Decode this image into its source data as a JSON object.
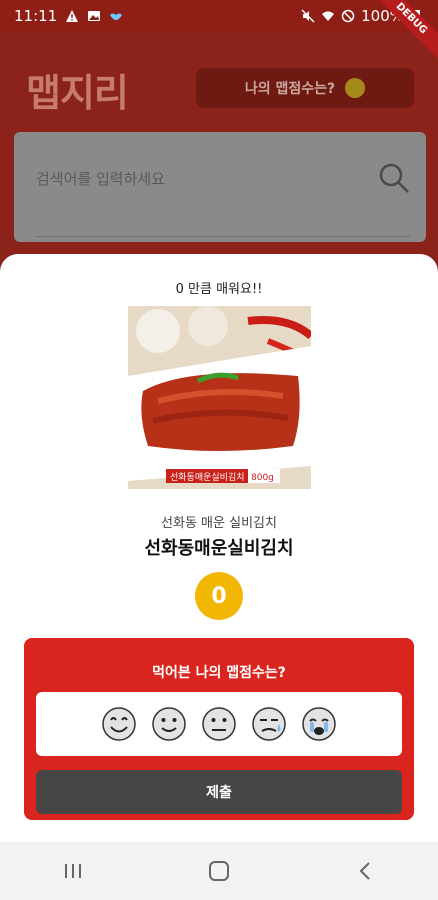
{
  "status_bar": {
    "time": "11:11",
    "battery": "100%"
  },
  "debug_label": "DEBUG",
  "app": {
    "logo": "맵지리",
    "score_button": "나의 맵점수는?",
    "search_placeholder": "검색어를 입력하세요"
  },
  "sheet": {
    "title": "0 만큼 매워요!!",
    "product_subtitle": "선화동 매운 실비김치",
    "product_name": "선화동매운실비김치",
    "score": "0",
    "image_label": "선화동매운실비김치",
    "image_weight": "800g"
  },
  "rating": {
    "title": "먹어본 나의 맵점수는?",
    "faces": [
      "smile-big",
      "smile",
      "neutral",
      "sweat",
      "crying"
    ],
    "submit_label": "제출"
  },
  "colors": {
    "accent": "#d9251d",
    "score": "#f2b705",
    "button": "#464646"
  }
}
